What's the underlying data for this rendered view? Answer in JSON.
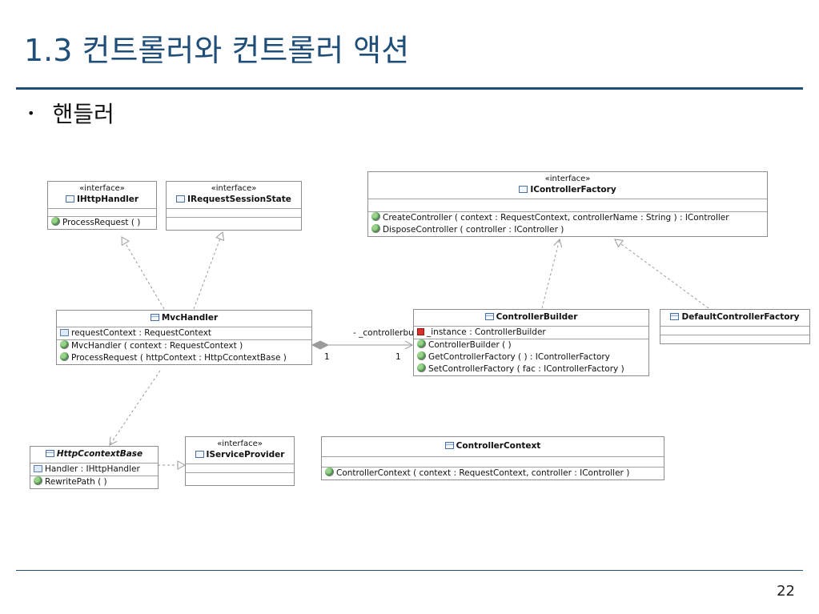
{
  "slide": {
    "title": "1.3 컨트롤러와 컨트롤러 액션",
    "bullet": "핸들러",
    "bullet_marker": "•",
    "page_number": "22"
  },
  "diagram": {
    "classes": {
      "ihttphandler": {
        "stereotype": "«interface»",
        "name": "IHttpHandler",
        "ops": [
          "ProcessRequest ( )"
        ]
      },
      "irequestsessionstate": {
        "stereotype": "«interface»",
        "name": "IRequestSessionState"
      },
      "icontrollerfactory": {
        "stereotype": "«interface»",
        "name": "IControllerFactory",
        "ops": [
          "CreateController ( context : RequestContext, controllerName : String ) : IController",
          "DisposeController ( controller : IController )"
        ]
      },
      "mvchandler": {
        "name": "MvcHandler",
        "attrs": [
          "requestContext : RequestContext"
        ],
        "ops": [
          "MvcHandler ( context : RequestContext )",
          "ProcessRequest ( httpContext : HttpCcontextBase )"
        ]
      },
      "controllerbuilder": {
        "name": "ControllerBuilder",
        "attrs": [
          "_instance : ControllerBuilder"
        ],
        "ops": [
          "ControllerBuilder ( )",
          "GetControllerFactory ( ) : IControllerFactory",
          "SetControllerFactory ( fac : IControllerFactory )"
        ]
      },
      "defaultcontrollerfactory": {
        "name": "DefaultControllerFactory"
      },
      "httpccontextbase": {
        "name": "HttpCcontextBase",
        "attrs": [
          "Handler : IHttpHandler"
        ],
        "ops": [
          "RewritePath ( )"
        ]
      },
      "iserviceprovider": {
        "stereotype": "«interface»",
        "name": "IServiceProvider"
      },
      "controllercontext": {
        "name": "ControllerContext",
        "ops": [
          "ControllerContext ( context : RequestContext, controller : IController )"
        ]
      }
    },
    "association": {
      "role": "- _controllerbuilder",
      "mult_source": "1",
      "mult_target": "1"
    },
    "colors": {
      "title": "#1f4e79",
      "rule": "#1f4e79",
      "edge": "#9a9a9a",
      "box_border": "#8d8d8d"
    },
    "icons": {
      "class": "class-icon",
      "interface": "interface-icon",
      "operation": "operation-icon",
      "attribute": "attribute-icon",
      "static_attribute": "static-attribute-icon"
    }
  }
}
